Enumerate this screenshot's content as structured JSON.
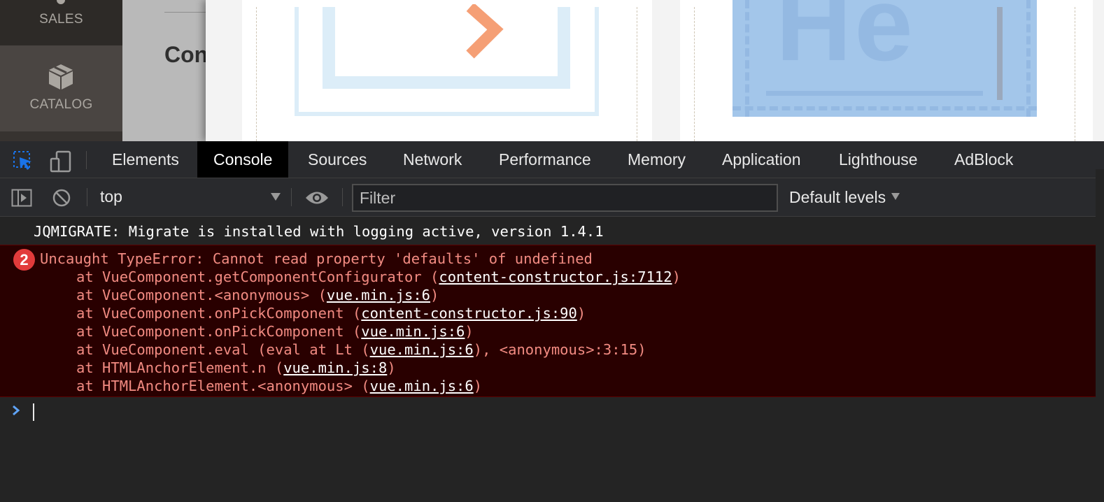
{
  "admin_menu": {
    "items": [
      {
        "label": "SALES",
        "icon": "dollar-icon"
      },
      {
        "label": "CATALOG",
        "icon": "box-icon"
      }
    ]
  },
  "page": {
    "title_partial": "Con"
  },
  "devtools": {
    "tabs": [
      {
        "label": "Elements",
        "active": false
      },
      {
        "label": "Console",
        "active": true
      },
      {
        "label": "Sources",
        "active": false
      },
      {
        "label": "Network",
        "active": false
      },
      {
        "label": "Performance",
        "active": false
      },
      {
        "label": "Memory",
        "active": false
      },
      {
        "label": "Application",
        "active": false
      },
      {
        "label": "Lighthouse",
        "active": false
      },
      {
        "label": "AdBlock",
        "active": false
      }
    ],
    "toolbar": {
      "context": "top",
      "filter_placeholder": "Filter",
      "levels": "Default levels"
    },
    "console": {
      "info_message": "JQMIGRATE: Migrate is installed with logging active, version 1.4.1",
      "error": {
        "count": "2",
        "message": "Uncaught TypeError: Cannot read property 'defaults' of undefined",
        "frames": [
          {
            "prefix": "at VueComponent.getComponentConfigurator (",
            "link": "content-constructor.js:7112",
            "suffix": ")"
          },
          {
            "prefix": "at VueComponent.<anonymous> (",
            "link": "vue.min.js:6",
            "suffix": ")"
          },
          {
            "prefix": "at VueComponent.onPickComponent (",
            "link": "content-constructor.js:90",
            "suffix": ")"
          },
          {
            "prefix": "at VueComponent.onPickComponent (",
            "link": "vue.min.js:6",
            "suffix": ")"
          },
          {
            "prefix": "at VueComponent.eval (eval at Lt (",
            "link": "vue.min.js:6",
            "suffix": "), <anonymous>:3:15)"
          },
          {
            "prefix": "at HTMLAnchorElement.n (",
            "link": "vue.min.js:8",
            "suffix": ")"
          },
          {
            "prefix": "at HTMLAnchorElement.<anonymous> (",
            "link": "vue.min.js:6",
            "suffix": ")"
          }
        ]
      }
    },
    "colors": {
      "error_bg": "#290000",
      "error_text": "#f28b82",
      "badge": "#e23b3b",
      "select_icon": "#1a73e8"
    }
  }
}
